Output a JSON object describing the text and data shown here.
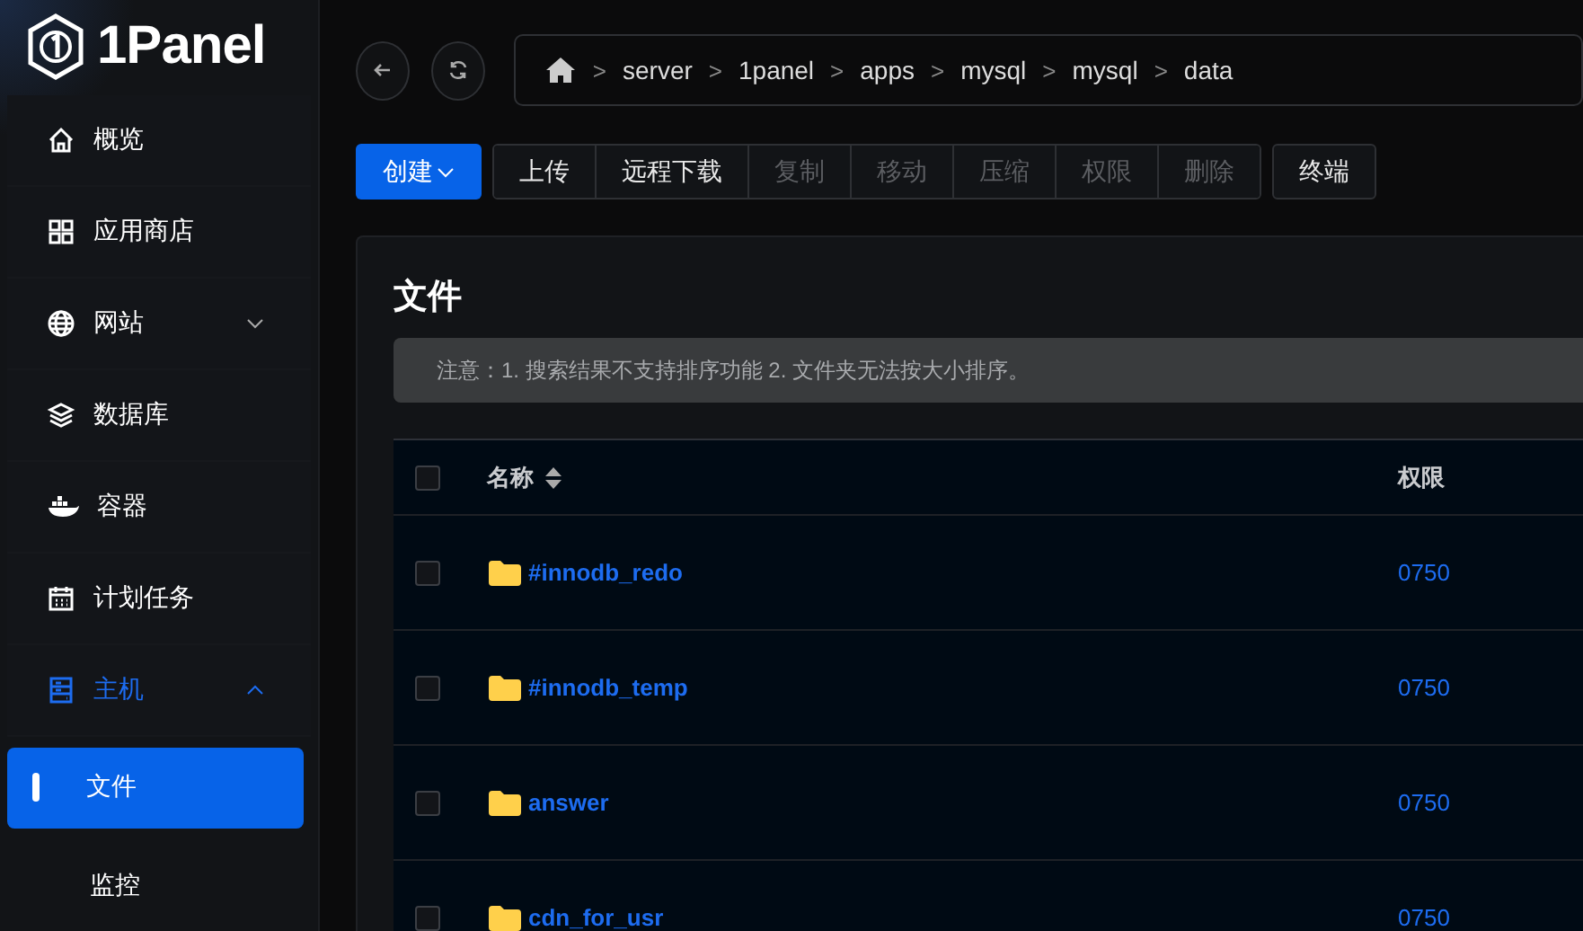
{
  "logo": {
    "text": "1Panel"
  },
  "sidebar": {
    "items": [
      {
        "label": "概览",
        "selected": false
      },
      {
        "label": "应用商店",
        "selected": false
      },
      {
        "label": "网站",
        "selected": false,
        "expanded": false
      },
      {
        "label": "数据库",
        "selected": false
      },
      {
        "label": "容器",
        "selected": false
      },
      {
        "label": "计划任务",
        "selected": false
      },
      {
        "label": "主机",
        "selected": false,
        "expanded": true,
        "children": [
          {
            "label": "文件",
            "selected": true
          },
          {
            "label": "监控",
            "selected": false
          }
        ]
      }
    ]
  },
  "breadcrumb": [
    {
      "separator": ">",
      "label": "server"
    },
    {
      "separator": ">",
      "label": "1panel"
    },
    {
      "separator": ">",
      "label": "apps"
    },
    {
      "separator": ">",
      "label": "mysql"
    },
    {
      "separator": ">",
      "label": "mysql"
    },
    {
      "separator": ">",
      "label": "data"
    }
  ],
  "toolbar": {
    "create": "创建",
    "actions": [
      {
        "label": "上传",
        "disabled": false
      },
      {
        "label": "远程下载",
        "disabled": false
      },
      {
        "label": "复制",
        "disabled": true
      },
      {
        "label": "移动",
        "disabled": true
      },
      {
        "label": "压缩",
        "disabled": true
      },
      {
        "label": "权限",
        "disabled": true
      },
      {
        "label": "删除",
        "disabled": true
      }
    ],
    "terminal": "终端"
  },
  "card": {
    "title": "文件",
    "notice": "注意：1. 搜索结果不支持排序功能 2. 文件夹无法按大小排序。"
  },
  "table": {
    "select_all_checked": false,
    "columns": [
      "名称",
      "权限"
    ],
    "rows": [
      {
        "name": "#innodb_redo",
        "permission": "0750",
        "checked": false
      },
      {
        "name": "#innodb_temp",
        "permission": "0750",
        "checked": false
      },
      {
        "name": "answer",
        "permission": "0750",
        "checked": false
      },
      {
        "name": "cdn_for_usr",
        "permission": "0750",
        "checked": false
      }
    ]
  }
}
